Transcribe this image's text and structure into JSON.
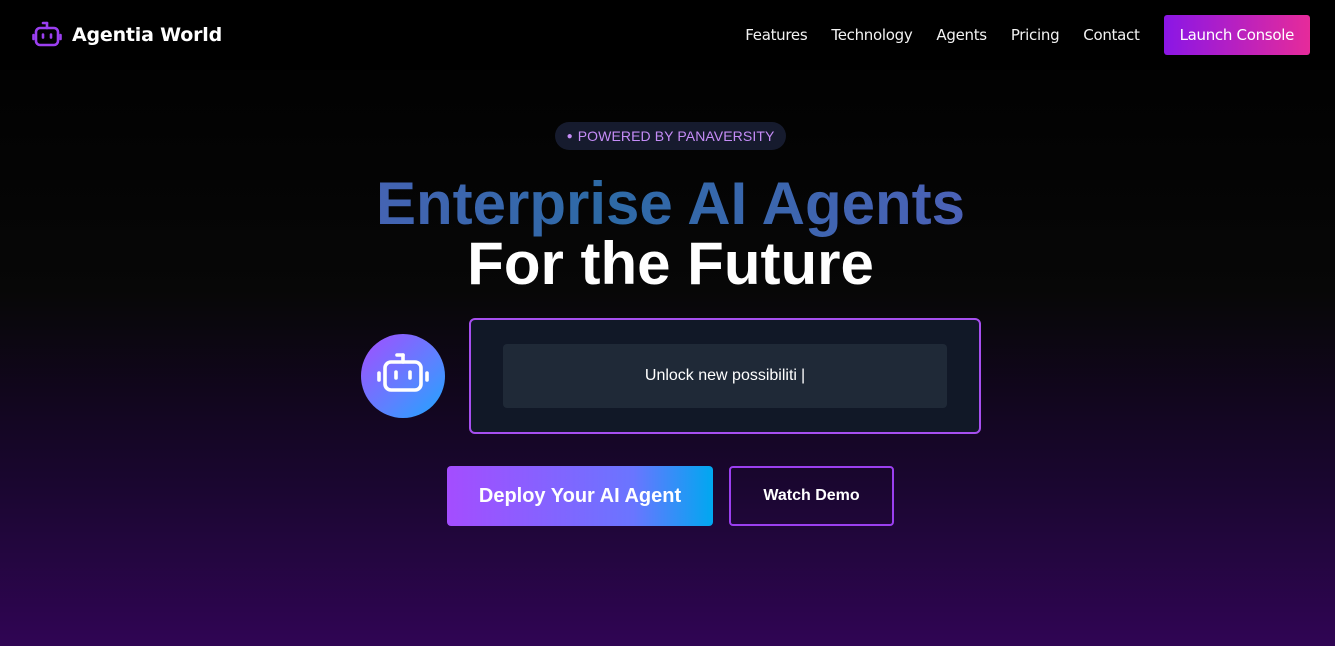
{
  "nav": {
    "brand": "Agentia World",
    "links": [
      "Features",
      "Technology",
      "Agents",
      "Pricing",
      "Contact"
    ],
    "cta": "Launch Console"
  },
  "hero": {
    "badge": "POWERED BY PANAVERSITY",
    "headline_line1": "Enterprise AI Agents",
    "headline_line2": "For the Future",
    "typing_text": "Unlock new possibiliti",
    "cursor": "|",
    "primary_button": "Deploy Your AI Agent",
    "secondary_button": "Watch Demo"
  },
  "icons": {
    "brand": "robot-icon",
    "avatar": "robot-icon"
  },
  "colors": {
    "brand_purple": "#9b3ff0",
    "cta_gradient_start": "#8a16e6",
    "cta_gradient_end": "#e62b9a",
    "badge_text": "#c58cf7"
  }
}
